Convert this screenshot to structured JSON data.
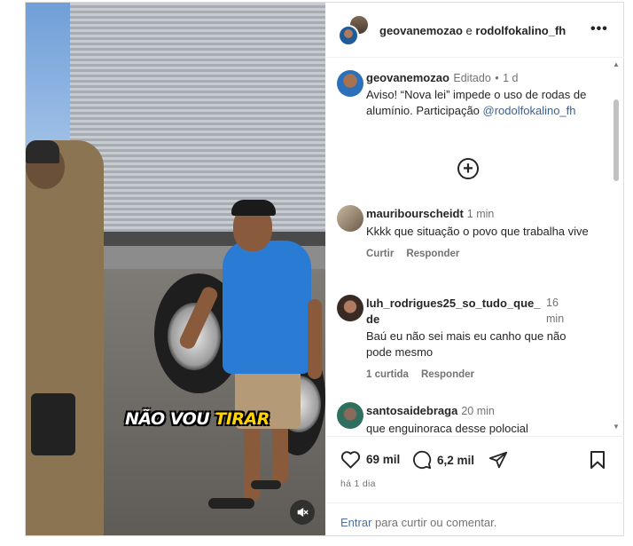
{
  "video": {
    "caption_white": "NÃO VOU ",
    "caption_yellow": "TIRAR",
    "mute_icon": "speaker-muted-icon"
  },
  "header": {
    "user1": "geovanemozao",
    "separator": " e ",
    "user2": "rodolfokalino_fh",
    "more_icon": "more-horizontal-icon",
    "more_label": "•••"
  },
  "post": {
    "author": "geovanemozao",
    "edited": "Editado",
    "dot": "•",
    "age": "1 d",
    "text": "Aviso! “Nova lei” impede o uso de rodas de alumínio. Participação ",
    "mention": "@rodolfokalino_fh",
    "load_more_label": "+"
  },
  "comments": [
    {
      "user": "mauribourscheidt",
      "time": "1 min",
      "text": "Kkkk que situação o povo que trabalha vive",
      "actions": [
        "Curtir",
        "Responder"
      ]
    },
    {
      "user_line1": "luh_rodrigues25_so_tudo_que_",
      "user_line2": "de",
      "time_line1": "16",
      "time_line2": "min",
      "text": "Baú eu não sei mais eu canho que não pode mesmo",
      "actions": [
        "1 curtida",
        "Responder"
      ]
    },
    {
      "user": "santosaidebraga",
      "time": "20 min",
      "text": "que enguinoraca desse polocial"
    }
  ],
  "engagement": {
    "likes": "69 mil",
    "comments": "6,2 mil",
    "like_icon": "heart-icon",
    "comment_icon": "comment-bubble-icon",
    "share_icon": "share-paper-plane-icon",
    "save_icon": "bookmark-icon",
    "posted": "há 1 dia"
  },
  "login": {
    "link": "Entrar",
    "text": " para curtir ou comentar."
  },
  "colors": {
    "link": "#4f6ea3",
    "mention": "#3e5f8f",
    "shirt": "#2a7bd3",
    "caption_yellow": "#ffd400"
  }
}
